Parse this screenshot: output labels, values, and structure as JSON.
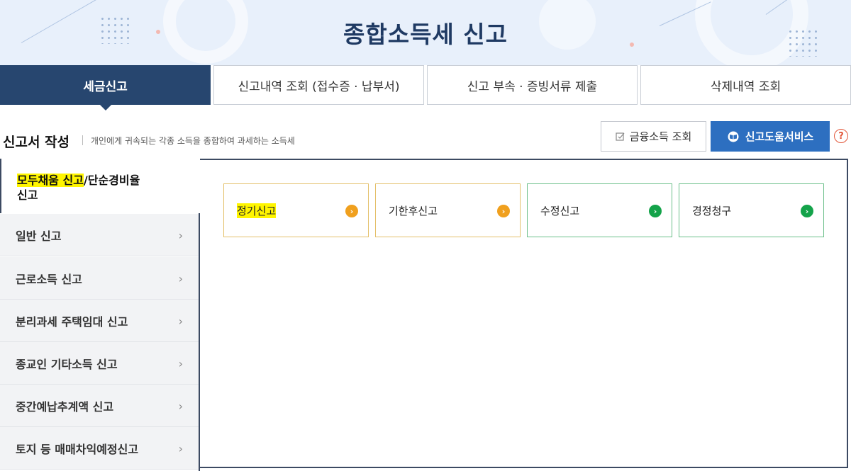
{
  "header": {
    "title": "종합소득세 신고"
  },
  "tabs": [
    {
      "label": "세금신고",
      "active": true
    },
    {
      "label": "신고내역 조회 (접수증 · 납부서)",
      "active": false
    },
    {
      "label": "신고 부속 · 증빙서류 제출",
      "active": false
    },
    {
      "label": "삭제내역 조회",
      "active": false
    }
  ],
  "section": {
    "title": "신고서 작성",
    "description": "개인에게 귀속되는 각종 소득을 종합하여 과세하는 소득세"
  },
  "actions": {
    "financial_income_label": "금융소득 조회",
    "help_service_label": "신고도움서비스",
    "help_icon": "question-circle-icon",
    "help_glyph": "?"
  },
  "sidebar": {
    "active": {
      "part1": "모두채움 신고",
      "part2": "/단순경비율",
      "part3": "신고"
    },
    "items": [
      {
        "label": "일반 신고"
      },
      {
        "label": "근로소득 신고"
      },
      {
        "label": "분리과세 주택임대 신고"
      },
      {
        "label": "종교인 기타소득 신고"
      },
      {
        "label": "중간예납추계액 신고"
      },
      {
        "label": "토지 등 매매차익예정신고"
      }
    ],
    "chevron": "›"
  },
  "cards": [
    {
      "label": "정기신고",
      "color": "#f0a01e",
      "highlighted": true
    },
    {
      "label": "기한후신고",
      "color": "#f0a01e",
      "highlighted": false
    },
    {
      "label": "수정신고",
      "color": "#14a34a",
      "highlighted": false
    },
    {
      "label": "경정청구",
      "color": "#14a34a",
      "highlighted": false
    }
  ],
  "card_arrow": "›",
  "colors": {
    "primary_navy": "#27466f",
    "help_blue": "#2d6fc0",
    "highlight_yellow": "#fff500",
    "accent_orange": "#f0a01e",
    "accent_green": "#14a34a"
  }
}
